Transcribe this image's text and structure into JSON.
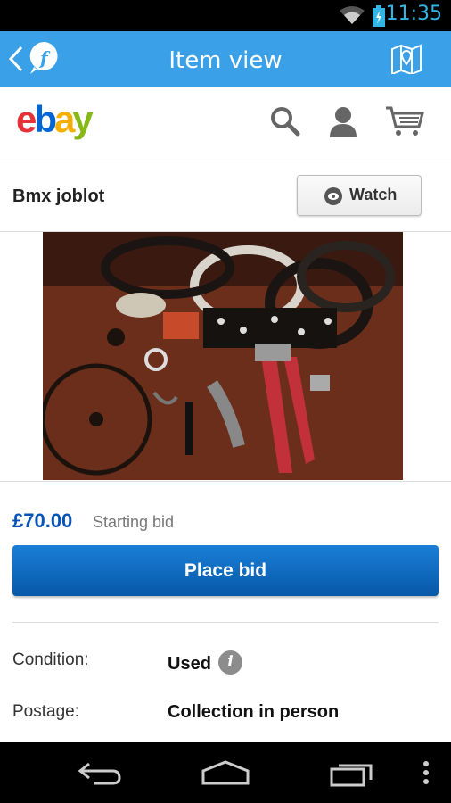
{
  "status": {
    "time": "11:35"
  },
  "appbar": {
    "title": "Item view"
  },
  "ebay": {
    "logo": [
      "e",
      "b",
      "a",
      "y"
    ]
  },
  "item": {
    "title": "Bmx joblot",
    "watch_label": "Watch",
    "image_count": 8,
    "active_image": 1,
    "price": "£70.00",
    "price_label": "Starting bid",
    "place_bid_label": "Place bid",
    "condition_label": "Condition:",
    "condition_value": "Used",
    "info_glyph": "i",
    "postage_label": "Postage:",
    "postage_value": "Collection in person"
  },
  "colors": {
    "accent": "#3aa0e8",
    "ebay_blue": "#0654ba"
  }
}
